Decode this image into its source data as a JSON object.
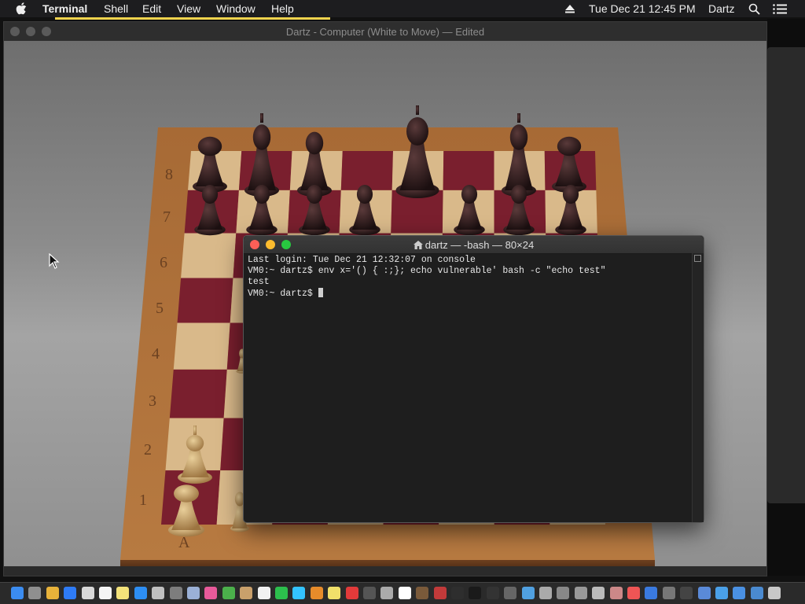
{
  "menubar": {
    "apple_icon": "apple-logo-icon",
    "app_name": "Terminal",
    "items": [
      "Shell",
      "Edit",
      "View",
      "Window",
      "Help"
    ],
    "clock": "Tue Dec 21  12:45 PM",
    "user": "Dartz",
    "status_icons": [
      "eject-icon",
      "spotlight-search-icon",
      "notification-center-icon"
    ]
  },
  "chess_window": {
    "title": "Dartz - Computer   (White to Move) — Edited",
    "rank_labels": [
      "8",
      "7",
      "6",
      "5",
      "4",
      "3",
      "2",
      "1"
    ],
    "file_labels": [
      "A"
    ]
  },
  "terminal": {
    "title": "dartz — -bash — 80×24",
    "title_icon": "home-folder-icon",
    "lines": [
      "Last login: Tue Dec 21 12:32:07 on console",
      "VM0:~ dartz$ env x='() { :;}; echo vulnerable' bash -c \"echo test\"",
      "test"
    ],
    "prompt": "VM0:~ dartz$ "
  },
  "colors": {
    "menubar_bg": "#1d1d1f",
    "terminal_bg": "#1e1e1e",
    "close": "#fc5f57",
    "minimize": "#fdbc2e",
    "zoom": "#28c840",
    "board_dark": "#7a1f2e",
    "board_light": "#d9b98a",
    "frame_wood": "#a56a36"
  },
  "dock_icons": [
    "finder-icon",
    "launchpad-icon",
    "chrome-icon",
    "safari-icon",
    "mail-icon",
    "calendar-icon",
    "notes-icon",
    "app-store-icon",
    "photos-icon",
    "system-preferences-icon",
    "preview-icon",
    "itunes-icon",
    "maps-icon",
    "contacts-icon",
    "reminders-icon",
    "facetime-icon",
    "messages-icon",
    "ibooks-icon",
    "stickies-icon",
    "no-entry-icon",
    "dictionary-icon",
    "font-book-icon",
    "textedit-icon",
    "chess-icon",
    "photo-booth-icon",
    "activity-monitor-icon",
    "terminal-icon",
    "console-icon",
    "digital-color-meter-icon",
    "grapher-icon",
    "keychain-icon",
    "script-editor-icon",
    "system-information-icon",
    "disk-utility-icon",
    "migration-assistant-icon",
    "audio-midi-icon",
    "bluetooth-icon",
    "boot-camp-icon",
    "voiceover-icon",
    "utilities-icon",
    "downloads-folder-icon",
    "applications-folder-icon",
    "documents-folder-icon",
    "trash-icon"
  ]
}
